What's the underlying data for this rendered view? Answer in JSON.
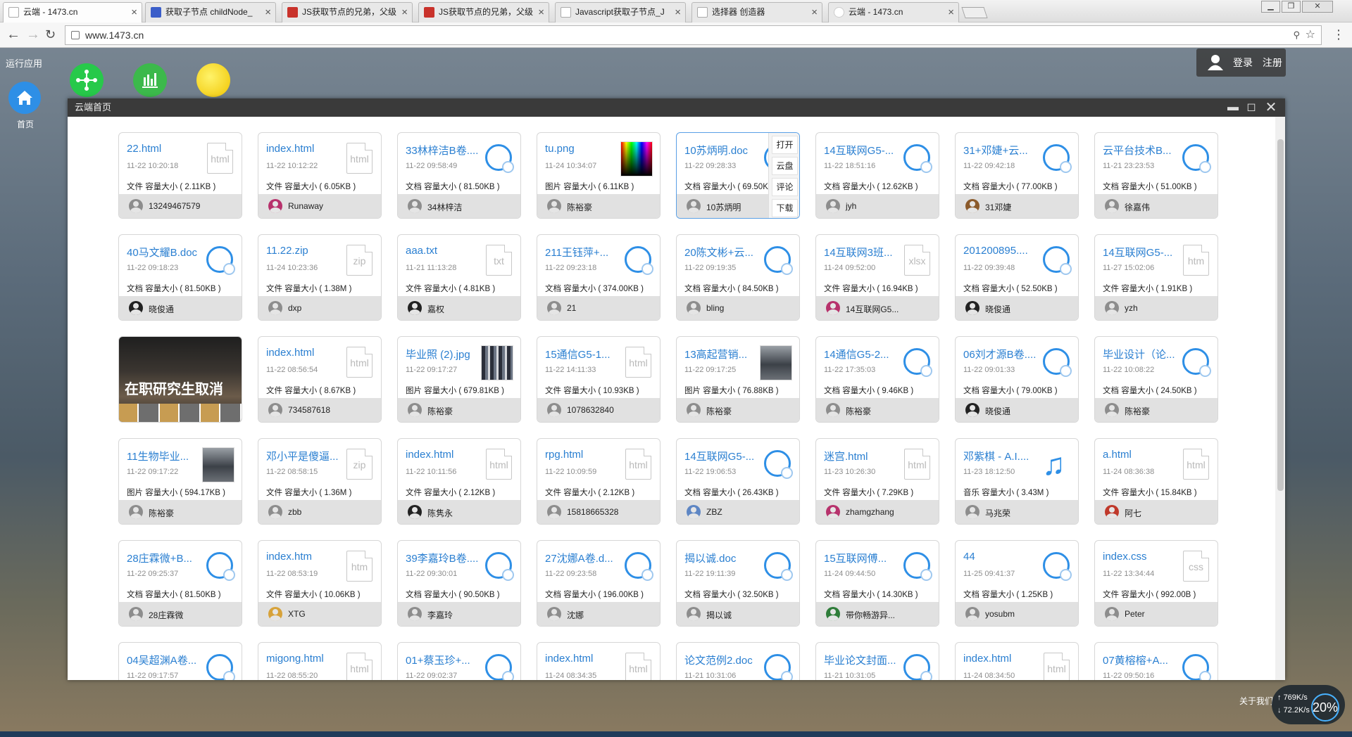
{
  "browser": {
    "tabs": [
      {
        "title": "云端 - 1473.cn",
        "icon": "page-icon"
      },
      {
        "title": "获取子节点 childNode_",
        "icon": "site-icon"
      },
      {
        "title": "JS获取节点的兄弟，父级",
        "icon": "csdn-icon"
      },
      {
        "title": "JS获取节点的兄弟，父级",
        "icon": "csdn-icon"
      },
      {
        "title": "Javascript获取子节点_J",
        "icon": "page-icon"
      },
      {
        "title": "选择器 创造器",
        "icon": "page-icon"
      },
      {
        "title": "云端 - 1473.cn",
        "icon": "cloud-icon"
      }
    ],
    "url": "www.1473.cn"
  },
  "desktop": {
    "launch_label": "运行应用",
    "home_label": "首页"
  },
  "auth": {
    "login": "登录",
    "register": "注册"
  },
  "window": {
    "title": "云端首页"
  },
  "menu": {
    "open": "打开",
    "cloud": "云盘",
    "comment": "评论",
    "download": "下载"
  },
  "files": [
    {
      "title": "22.html",
      "date": "11-22 10:20:18",
      "info": "文件 容量大小 ( 2.11KB )",
      "user": "13249467579",
      "icon": "ext",
      "ext": "html",
      "avatar": "default"
    },
    {
      "title": "index.html",
      "date": "11-22 10:12:22",
      "info": "文件 容量大小 ( 6.05KB )",
      "user": "Runaway",
      "icon": "ext",
      "ext": "html",
      "avatar": "pink"
    },
    {
      "title": "33林梓洁B卷....",
      "date": "11-22 09:58:49",
      "info": "文档 容量大小 ( 81.50KB )",
      "user": "34林梓洁",
      "icon": "ring",
      "avatar": "default"
    },
    {
      "title": "tu.png",
      "date": "11-24 10:34:07",
      "info": "图片 容量大小 ( 6.11KB )",
      "user": "陈裕豪",
      "icon": "spec",
      "avatar": "default"
    },
    {
      "title": "10苏炳明.doc",
      "date": "11-22 09:28:33",
      "info": "文档 容量大小 ( 69.50KB )",
      "user": "10苏炳明",
      "icon": "ring",
      "avatar": "default",
      "menu": true
    },
    {
      "title": "14互联网G5-...",
      "date": "11-22 18:51:16",
      "info": "文档 容量大小 ( 12.62KB )",
      "user": "jyh",
      "icon": "ring",
      "avatar": "default"
    },
    {
      "title": "31+邓婕+云...",
      "date": "11-22 09:42:18",
      "info": "文档 容量大小 ( 77.00KB )",
      "user": "31邓婕",
      "icon": "ring",
      "avatar": "brown"
    },
    {
      "title": "云平台技术B...",
      "date": "11-21 23:23:53",
      "info": "文档 容量大小 ( 51.00KB )",
      "user": "徐嘉伟",
      "icon": "ring",
      "avatar": "default"
    },
    {
      "title": "40马文耀B.doc",
      "date": "11-22 09:18:23",
      "info": "文档 容量大小 ( 81.50KB )",
      "user": "晓俊通",
      "icon": "ring",
      "avatar": "dark"
    },
    {
      "title": "11.22.zip",
      "date": "11-24 10:23:36",
      "info": "文件 容量大小 ( 1.38M )",
      "user": "dxp",
      "icon": "ext",
      "ext": "zip",
      "avatar": "default"
    },
    {
      "title": "aaa.txt",
      "date": "11-21 11:13:28",
      "info": "文件 容量大小 ( 4.81KB )",
      "user": "嘉权",
      "icon": "ext",
      "ext": "txt",
      "avatar": "dark"
    },
    {
      "title": "211王钰萍+...",
      "date": "11-22 09:23:18",
      "info": "文档 容量大小 ( 374.00KB )",
      "user": "21",
      "icon": "ring",
      "avatar": "default"
    },
    {
      "title": "20陈文彬+云...",
      "date": "11-22 09:19:35",
      "info": "文档 容量大小 ( 84.50KB )",
      "user": "bling",
      "icon": "ring",
      "avatar": "default"
    },
    {
      "title": "14互联网3班...",
      "date": "11-24 09:52:00",
      "info": "文件 容量大小 ( 16.94KB )",
      "user": "14互联网G5...",
      "icon": "ext",
      "ext": "xlsx",
      "avatar": "pink"
    },
    {
      "title": "201200895....",
      "date": "11-22 09:39:48",
      "info": "文档 容量大小 ( 52.50KB )",
      "user": "晓俊通",
      "icon": "ring",
      "avatar": "dark"
    },
    {
      "title": "14互联网G5-...",
      "date": "11-27 15:02:06",
      "info": "文件 容量大小 ( 1.91KB )",
      "user": "yzh",
      "icon": "ext",
      "ext": "htm",
      "avatar": "default"
    },
    {
      "title": "",
      "date": "",
      "info": "",
      "user": "",
      "icon": "bigthumb",
      "thumb_text": "在职研究生取消",
      "avatar": "none"
    },
    {
      "title": "index.html",
      "date": "11-22 08:56:54",
      "info": "文件 容量大小 ( 8.67KB )",
      "user": "734587618",
      "icon": "ext",
      "ext": "html",
      "avatar": "default"
    },
    {
      "title": "毕业照 (2).jpg",
      "date": "11-22 09:17:27",
      "info": "图片 容量大小 ( 679.81KB )",
      "user": "陈裕豪",
      "icon": "crowd",
      "avatar": "default"
    },
    {
      "title": "15通信G5-1...",
      "date": "11-22 14:11:33",
      "info": "文件 容量大小 ( 10.93KB )",
      "user": "1078632840",
      "icon": "ext",
      "ext": "html",
      "avatar": "default"
    },
    {
      "title": "13高起营销...",
      "date": "11-22 09:17:25",
      "info": "图片 容量大小 ( 76.88KB )",
      "user": "陈裕豪",
      "icon": "photo",
      "avatar": "default"
    },
    {
      "title": "14通信G5-2...",
      "date": "11-22 17:35:03",
      "info": "文档 容量大小 ( 9.46KB )",
      "user": "陈裕豪",
      "icon": "ring",
      "avatar": "default"
    },
    {
      "title": "06刘才源B卷....",
      "date": "11-22 09:01:33",
      "info": "文档 容量大小 ( 79.00KB )",
      "user": "晓俊通",
      "icon": "ring",
      "avatar": "dark"
    },
    {
      "title": "毕业设计（论...",
      "date": "11-22 10:08:22",
      "info": "文档 容量大小 ( 24.50KB )",
      "user": "陈裕豪",
      "icon": "ring",
      "avatar": "default"
    },
    {
      "title": "11生物毕业...",
      "date": "11-22 09:17:22",
      "info": "图片 容量大小 ( 594.17KB )",
      "user": "陈裕豪",
      "icon": "photo",
      "avatar": "default"
    },
    {
      "title": "邓小平是傻逼...",
      "date": "11-22 08:58:15",
      "info": "文件 容量大小 ( 1.36M )",
      "user": "zbb",
      "icon": "ext",
      "ext": "zip",
      "avatar": "default"
    },
    {
      "title": "index.html",
      "date": "11-22 10:11:56",
      "info": "文件 容量大小 ( 2.12KB )",
      "user": "陈隽永",
      "icon": "ext",
      "ext": "html",
      "avatar": "dark"
    },
    {
      "title": "rpg.html",
      "date": "11-22 10:09:59",
      "info": "文件 容量大小 ( 2.12KB )",
      "user": "15818665328",
      "icon": "ext",
      "ext": "html",
      "avatar": "default"
    },
    {
      "title": "14互联网G5-...",
      "date": "11-22 19:06:53",
      "info": "文档 容量大小 ( 26.43KB )",
      "user": "ZBZ",
      "icon": "ring",
      "avatar": "blue"
    },
    {
      "title": "迷宫.html",
      "date": "11-23 10:26:30",
      "info": "文件 容量大小 ( 7.29KB )",
      "user": "zhamgzhang",
      "icon": "ext",
      "ext": "html",
      "avatar": "pink"
    },
    {
      "title": "邓紫棋 - A.I....",
      "date": "11-23 18:12:50",
      "info": "音乐 容量大小 ( 3.43M )",
      "user": "马兆荣",
      "icon": "music",
      "avatar": "default"
    },
    {
      "title": "a.html",
      "date": "11-24 08:36:38",
      "info": "文件 容量大小 ( 15.84KB )",
      "user": "阿七",
      "icon": "ext",
      "ext": "html",
      "avatar": "red"
    },
    {
      "title": "28庄霖微+B...",
      "date": "11-22 09:25:37",
      "info": "文档 容量大小 ( 81.50KB )",
      "user": "28庄霖微",
      "icon": "ring",
      "avatar": "default"
    },
    {
      "title": "index.htm",
      "date": "11-22 08:53:19",
      "info": "文件 容量大小 ( 10.06KB )",
      "user": "XTG",
      "icon": "ext",
      "ext": "htm",
      "avatar": "gold"
    },
    {
      "title": "39李嘉玲B卷....",
      "date": "11-22 09:30:01",
      "info": "文档 容量大小 ( 90.50KB )",
      "user": "李嘉玲",
      "icon": "ring",
      "avatar": "default"
    },
    {
      "title": "27沈娜A卷.d...",
      "date": "11-22 09:23:58",
      "info": "文档 容量大小 ( 196.00KB )",
      "user": "沈娜",
      "icon": "ring",
      "avatar": "default"
    },
    {
      "title": "揭以诚.doc",
      "date": "11-22 19:11:39",
      "info": "文档 容量大小 ( 32.50KB )",
      "user": "揭以诚",
      "icon": "ring",
      "avatar": "default"
    },
    {
      "title": "15互联网傅...",
      "date": "11-24 09:44:50",
      "info": "文档 容量大小 ( 14.30KB )",
      "user": "带你畅游异...",
      "icon": "ring",
      "avatar": "green"
    },
    {
      "title": "44",
      "date": "11-25 09:41:37",
      "info": "文档 容量大小 ( 1.25KB )",
      "user": "yosubm",
      "icon": "ring",
      "avatar": "default"
    },
    {
      "title": "index.css",
      "date": "11-22 13:34:44",
      "info": "文件 容量大小 ( 992.00B )",
      "user": "Peter",
      "icon": "ext",
      "ext": "css",
      "avatar": "default"
    },
    {
      "title": "04吴超渊A卷...",
      "date": "11-22 09:17:57",
      "info": "",
      "user": "",
      "icon": "ring",
      "avatar": "default"
    },
    {
      "title": "migong.html",
      "date": "11-22 08:55:20",
      "info": "",
      "user": "",
      "icon": "ext",
      "ext": "html",
      "avatar": "default"
    },
    {
      "title": "01+蔡玉珍+...",
      "date": "11-22 09:02:37",
      "info": "",
      "user": "",
      "icon": "ring",
      "avatar": "default"
    },
    {
      "title": "index.html",
      "date": "11-24 08:34:35",
      "info": "",
      "user": "",
      "icon": "ext",
      "ext": "html",
      "avatar": "default"
    },
    {
      "title": "论文范例2.doc",
      "date": "11-21 10:31:06",
      "info": "",
      "user": "",
      "icon": "ring",
      "avatar": "default"
    },
    {
      "title": "毕业论文封面...",
      "date": "11-21 10:31:05",
      "info": "",
      "user": "",
      "icon": "ring",
      "avatar": "default"
    },
    {
      "title": "index.html",
      "date": "11-24 08:34:50",
      "info": "",
      "user": "",
      "icon": "ext",
      "ext": "html",
      "avatar": "default"
    },
    {
      "title": "07黄榕榕+A...",
      "date": "11-22 09:50:16",
      "info": "",
      "user": "",
      "icon": "ring",
      "avatar": "default"
    }
  ],
  "status": {
    "about": "关于我们",
    "upload": "769K/s",
    "download": "72.2K/s",
    "cpu": "20%"
  }
}
